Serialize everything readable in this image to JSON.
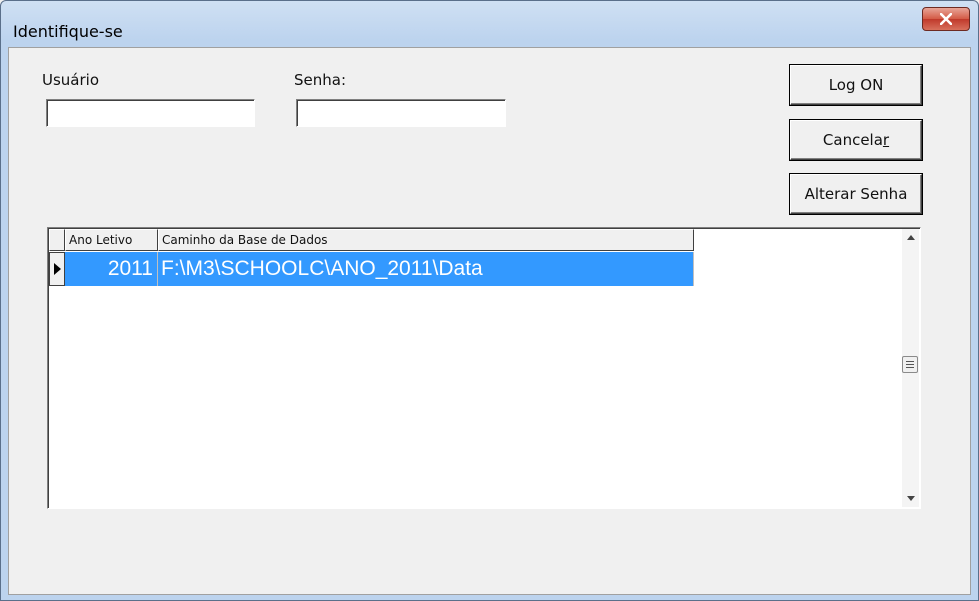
{
  "window": {
    "title": "Identifique-se",
    "close_glyph": "X"
  },
  "form": {
    "user_label": "Usuário",
    "user_value": "",
    "password_label": "Senha:",
    "password_value": ""
  },
  "buttons": {
    "log_on": "Log ON",
    "cancel_prefix": "Cancela",
    "cancel_mnemonic": "r",
    "change_password": "Alterar Senha"
  },
  "grid": {
    "columns": [
      "Ano Letivo",
      "Caminho da Base de Dados"
    ],
    "rows": [
      {
        "year": "2011",
        "path": "F:\\M3\\SCHOOLC\\ANO_2011\\Data"
      }
    ]
  },
  "icons": [
    "close-icon",
    "row-pointer-icon",
    "scroll-up-icon",
    "scroll-down-icon",
    "scroll-thumb-grip-icon"
  ],
  "colors": {
    "selection": "#3399ff",
    "close_button": "#c0392b"
  }
}
